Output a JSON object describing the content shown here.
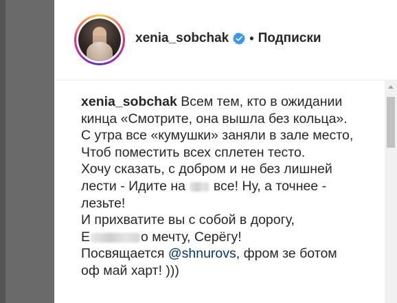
{
  "post": {
    "username": "xenia_sobchak",
    "separator": "•",
    "follow_label": "Подписки",
    "verified_icon": "verified-badge-icon",
    "verified_color": "#3897f0"
  },
  "caption": {
    "author": "xenia_sobchak",
    "line1_rest": "Всем тем, кто в ожидании",
    "line2": "кинца «Смотрите, она вышла без кольца».",
    "line3": "С утра все «кумушки» заняли в зале место,",
    "line4": "Чтоб поместить всех сплетен тесто.",
    "line5": "Хочу сказать, с добром и не без лишней",
    "line6_a": "лести - Идите на",
    "line6_b": "все! Ну, а точнее -",
    "line7": "лезьте!",
    "line8": "И прихватите вы с собой в дорогу,",
    "line9_a": "Е",
    "line9_b": "о мечту, Серёгу!",
    "line10_a": "Посвящается",
    "mention": "@shnurovs",
    "line10_b": ", фром зе ботом",
    "line11": "оф май харт! )))"
  },
  "colors": {
    "text": "#262626",
    "mention": "#00376b",
    "media_bg": "#6a6a6a"
  }
}
